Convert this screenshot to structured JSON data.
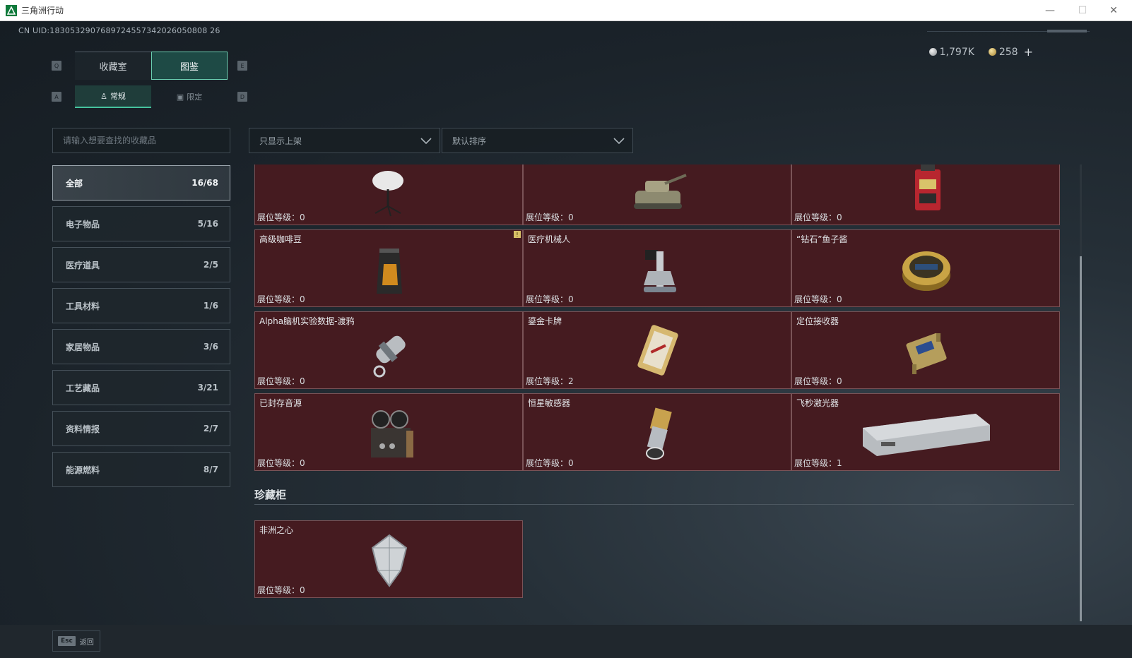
{
  "window": {
    "title": "三角洲行动"
  },
  "uid_text": "CN UID:1830532907689724557342026050808 26",
  "currency": {
    "silver": "1,797K",
    "gold": "258",
    "plus": "+"
  },
  "keys": {
    "prev_tab": "Q",
    "next_tab": "E",
    "prev_sub": "A",
    "next_sub": "D"
  },
  "tabs": [
    {
      "label": "收藏室"
    },
    {
      "label": "图鉴"
    }
  ],
  "subtabs": [
    {
      "label": "常规"
    },
    {
      "label": "限定"
    }
  ],
  "search": {
    "placeholder": "请输入想要查找的收藏品",
    "value": ""
  },
  "filters": {
    "shelf": "只显示上架",
    "sort": "默认排序"
  },
  "categories": [
    {
      "label": "全部",
      "count": "16/68"
    },
    {
      "label": "电子物品",
      "count": "5/16"
    },
    {
      "label": "医疗道具",
      "count": "2/5"
    },
    {
      "label": "工具材料",
      "count": "1/6"
    },
    {
      "label": "家居物品",
      "count": "3/6"
    },
    {
      "label": "工艺藏品",
      "count": "3/21"
    },
    {
      "label": "资料情报",
      "count": "2/7"
    },
    {
      "label": "能源燃料",
      "count": "8/7"
    }
  ],
  "level_prefix": "展位等级：",
  "items": [
    {
      "name": "",
      "level": "0",
      "icon": "satellite-dish-icon"
    },
    {
      "name": "",
      "level": "0",
      "icon": "tank-model-icon"
    },
    {
      "name": "",
      "level": "0",
      "icon": "red-device-icon"
    },
    {
      "name": "高级咖啡豆",
      "level": "0",
      "icon": "coffee-bag-icon",
      "new": true
    },
    {
      "name": "医疗机械人",
      "level": "0",
      "icon": "medical-robot-icon"
    },
    {
      "name": "“钻石”鱼子酱",
      "level": "0",
      "icon": "caviar-tin-icon"
    },
    {
      "name": "Alpha脑机实验数据-渡鸦",
      "level": "0",
      "icon": "data-capsule-icon"
    },
    {
      "name": "鎏金卡牌",
      "level": "2",
      "icon": "gold-card-icon"
    },
    {
      "name": "定位接收器",
      "level": "0",
      "icon": "gps-receiver-icon"
    },
    {
      "name": "已封存音源",
      "level": "0",
      "icon": "tape-recorder-icon"
    },
    {
      "name": "恒星敏感器",
      "level": "0",
      "icon": "star-sensor-icon"
    },
    {
      "name": "飞秒激光器",
      "level": "1",
      "icon": "laser-module-icon"
    }
  ],
  "cabinet": {
    "title": "珍藏柜",
    "items": [
      {
        "name": "非洲之心",
        "level": "0",
        "icon": "diamond-icon"
      }
    ]
  },
  "new_badge": "!",
  "bottom": {
    "esc_key": "Esc",
    "back_label": "返回"
  }
}
